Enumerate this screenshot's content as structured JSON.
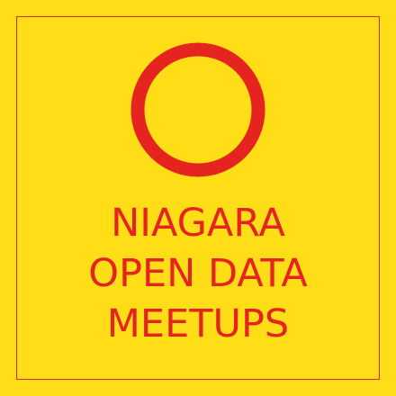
{
  "brand": {
    "background_color": "#FFDE17",
    "accent_color": "#E52420",
    "logo_icon": "ring-o-icon",
    "title_lines": [
      "NIAGARA",
      "OPEN DATA",
      "MEETUPS"
    ]
  }
}
